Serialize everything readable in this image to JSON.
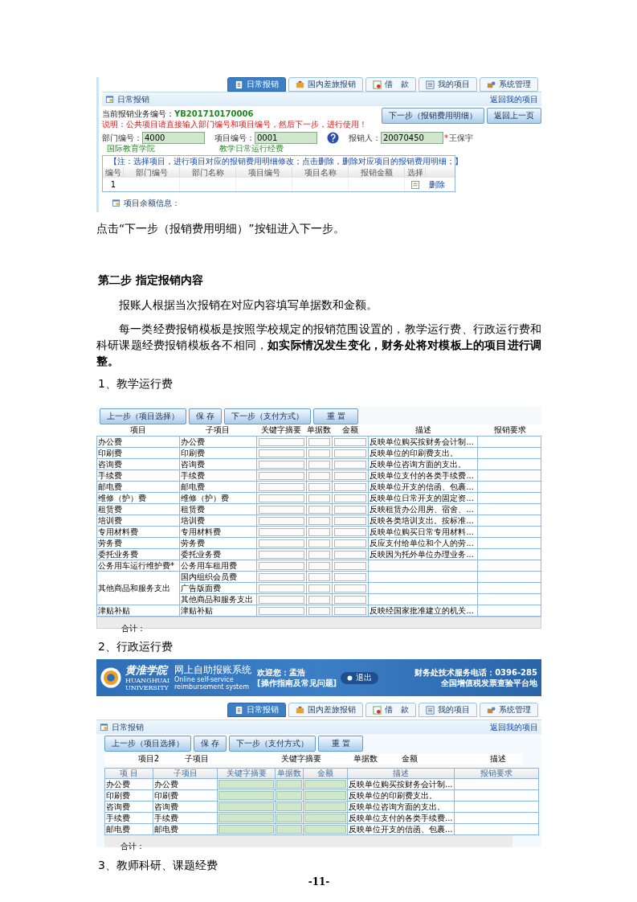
{
  "screenshot_1": {
    "nav_tabs": [
      {
        "label": "日常报销",
        "selected": true
      },
      {
        "label": "国内差旅报销",
        "selected": false
      },
      {
        "label": "借　款",
        "selected": false
      },
      {
        "label": "我的项目",
        "selected": false
      },
      {
        "label": "系统管理",
        "selected": false
      }
    ],
    "section_title": "日常报销",
    "back_link": "返回我的项目",
    "business_number_label": "当前报销业务编号：",
    "business_number": "YB201710170006",
    "note": "说明：公共项目请直接输入部门编号和项目编号，然后下一步，进行使用！",
    "buttons": [
      "下一步（报销费用明细）",
      "返回上一页"
    ],
    "fields": [
      {
        "label": "部门编号：",
        "value": "4000",
        "caption": "国际教育学院"
      },
      {
        "label": "项目编号：",
        "value": "0001",
        "caption": "教学日常运行经费"
      },
      {
        "label": "报销人：",
        "value": "20070450",
        "required_mark": "*",
        "suffix": "王保宇"
      }
    ],
    "table_note": "【注：选择项目，进行项目对应的报销费用明细修改；点击删除，删除对应项目的报销费用明细；】",
    "table": {
      "columns": [
        "编号",
        "部门编号",
        "部门名称",
        "项目编号",
        "项目名称",
        "报销金额",
        "选择"
      ],
      "rows": [
        {
          "number": "1",
          "action": "删除"
        }
      ]
    },
    "balance_label": "项目余额信息："
  },
  "caption": "点击“下一步（报销费用明细）”按钮进入下一步。",
  "step_heading": "第二步 指定报销内容",
  "paragraphs": [
    "报账人根据当次报销在对应内容填写单据数和金额。",
    "每一类经费报销模板是按照学校规定的报销范围设置的，教学运行费、行政运行费和科研课题经费报销模板各不相同，**如实际情况发生变化，财务处将对模板上的项目进行调整。**"
  ],
  "section_1": "1、教学运行费",
  "table_1": {
    "buttons": [
      "上一步（项目选择）",
      "保 存",
      "下一步（支付方式）",
      "重 置"
    ],
    "columns": [
      "项目",
      "子项目",
      "关键字摘要",
      "单据数",
      "金额",
      "描述",
      "报销要求"
    ],
    "rows": [
      {
        "item": "办公费",
        "subitems": [
          {
            "name": "办公费",
            "description": "反映单位购买按财务会计制..."
          }
        ]
      },
      {
        "item": "印刷费",
        "subitems": [
          {
            "name": "印刷费",
            "description": "反映单位的印刷费支出。"
          }
        ]
      },
      {
        "item": "咨询费",
        "subitems": [
          {
            "name": "咨询费",
            "description": "反映单位咨询方面的支出。"
          }
        ]
      },
      {
        "item": "手续费",
        "subitems": [
          {
            "name": "手续费",
            "description": "反映单位支付的各类手续费..."
          }
        ]
      },
      {
        "item": "邮电费",
        "subitems": [
          {
            "name": "邮电费",
            "description": "反映单位开支的信函、包裹..."
          }
        ]
      },
      {
        "item": "维修（护）费",
        "subitems": [
          {
            "name": "维修（护）费",
            "description": "反映单位日常开支的固定资..."
          }
        ]
      },
      {
        "item": "租赁费",
        "subitems": [
          {
            "name": "租赁费",
            "description": "反映租赁办公用房、宿舍、..."
          }
        ]
      },
      {
        "item": "培训费",
        "subitems": [
          {
            "name": "培训费",
            "description": "反映各类培训支出。按标准..."
          }
        ]
      },
      {
        "item": "专用材料费",
        "subitems": [
          {
            "name": "专用材料费",
            "description": "反映单位购买日常专用材料..."
          }
        ]
      },
      {
        "item": "劳务费",
        "subitems": [
          {
            "name": "劳务费",
            "description": "反应支付给单位和个人的劳..."
          }
        ]
      },
      {
        "item": "委托业务费",
        "subitems": [
          {
            "name": "委托业务费",
            "description": "反映因为托外单位办理业务..."
          }
        ]
      },
      {
        "item": "公务用车运行维护费*",
        "subitems": [
          {
            "name": "公务用车租用费"
          }
        ]
      },
      {
        "item": "其他商品和服务支出",
        "subitems": [
          {
            "name": "国内组织会员费"
          },
          {
            "name": "广告版面费"
          },
          {
            "name": "其他商品和服务支出"
          }
        ]
      },
      {
        "item": "津贴补贴",
        "subitems": [
          {
            "name": "津贴补贴",
            "description": "反映经国家批准建立的机关..."
          }
        ]
      }
    ],
    "total_label": "合计："
  },
  "section_2": "2、行政运行费",
  "screenshot_2": {
    "logo_text": "黄淮学院",
    "logo_subtext": "HUANGHUAI UNIVERSITY",
    "title": "网上自助报账系统",
    "subtitle": "Online self-service reimbursement system",
    "welcome_label": "欢迎您：",
    "user": "孟浩",
    "help_link": "[操作指南及常见问题]",
    "logout": "退出",
    "service_phone": "财务处技术服务电话：0396-285",
    "invoice_link": "全国增值税发票查验平台地",
    "nav_tabs": [
      {
        "label": "日常报销",
        "selected": true
      },
      {
        "label": "国内差旅报销",
        "selected": false
      },
      {
        "label": "借　款",
        "selected": false
      },
      {
        "label": "我的项目",
        "selected": false
      },
      {
        "label": "系统管理",
        "selected": false
      }
    ],
    "section_title": "日常报销",
    "back_link": "返回我的项目",
    "buttons": [
      "上一步（项目选择）",
      "保 存",
      "下一步（支付方式）",
      "重 置"
    ],
    "header_labels": [
      "项目2",
      "子项目",
      "关键字摘要",
      "单据数",
      "金额",
      "描述"
    ],
    "columns": [
      "项 目",
      "子项目",
      "关键字摘要",
      "单据数",
      "金额",
      "描述",
      "报销要求"
    ],
    "rows": [
      {
        "item": "办公费",
        "subitem": "办公费",
        "description": "反映单位购买按财务会计制..."
      },
      {
        "item": "印刷费",
        "subitem": "印刷费",
        "description": "反映单位的印刷费支出。"
      },
      {
        "item": "咨询费",
        "subitem": "咨询费",
        "description": "反映单位咨询方面的支出。"
      },
      {
        "item": "手续费",
        "subitem": "手续费",
        "description": "反映单位支付的各类手续费..."
      },
      {
        "item": "邮电费",
        "subitem": "邮电费",
        "description": "反映单位开支的信函、包裹..."
      }
    ],
    "total_label": "合计："
  },
  "section_3": "3、教师科研、课题经费",
  "page_number": "-11-"
}
